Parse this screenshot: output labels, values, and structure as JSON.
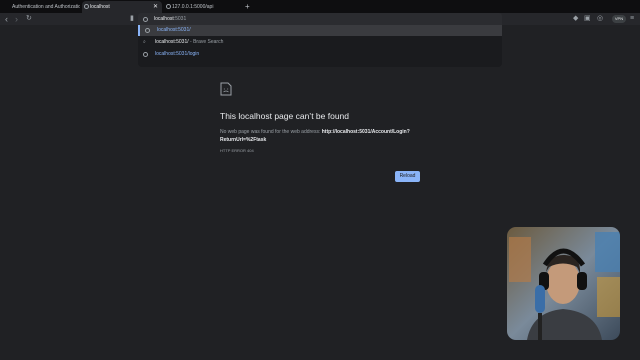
{
  "tabs": [
    {
      "title": "Authentication and Authorization",
      "active": false
    },
    {
      "title": "localhost",
      "active": true
    },
    {
      "title": "127.0.0.1:5000/api",
      "active": false
    }
  ],
  "newtab_symbol": "+",
  "toolbar": {
    "back_icon": "‹",
    "forward_icon": "›",
    "reload_icon": "↻",
    "vpn_label": "VPN"
  },
  "omnibox": {
    "typed": "localhost",
    "autocomplete": ":5031"
  },
  "suggestions": [
    {
      "bold": "localhost:5031",
      "rest": "/",
      "extra": "",
      "type": "url"
    },
    {
      "bold": "localhost:5031",
      "rest": "/",
      "extra": "- Brave Search",
      "type": "search"
    },
    {
      "bold": "localhost:5031",
      "rest": "/login",
      "extra": "",
      "type": "url"
    }
  ],
  "error": {
    "title": "This localhost page can’t be found",
    "desc_prefix": "No web page was found for the web address:",
    "url": "http://localhost:5031/Account/Login?ReturnUrl=%2Ftask",
    "code": "HTTP ERROR 404",
    "reload_label": "Reload"
  },
  "colors": {
    "accent": "#8ab4f8",
    "background": "#202124"
  }
}
